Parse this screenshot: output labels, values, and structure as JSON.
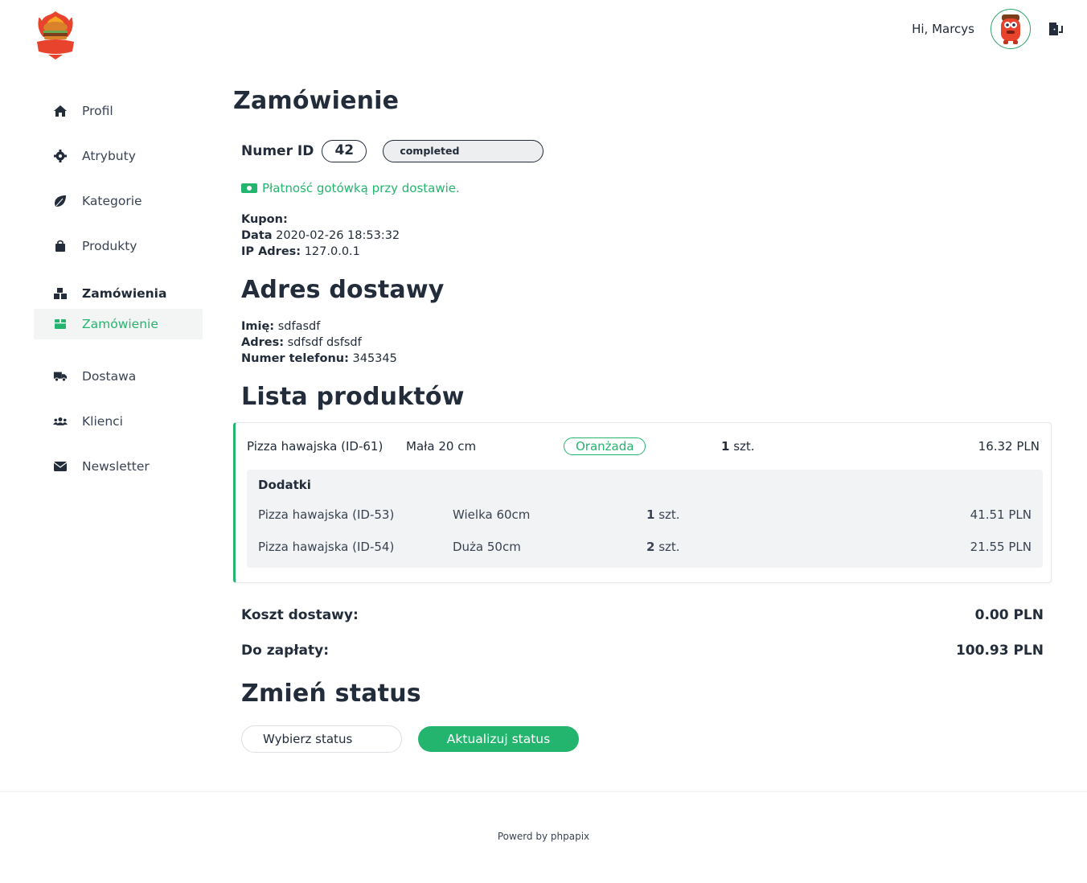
{
  "header": {
    "logo_text": "Burger",
    "greeting": "Hi, Marcys"
  },
  "sidebar": {
    "items": [
      {
        "label": "Profil",
        "icon": "home-icon"
      },
      {
        "label": "Atrybuty",
        "icon": "gear-icon"
      },
      {
        "label": "Kategorie",
        "icon": "leaf-icon"
      },
      {
        "label": "Produkty",
        "icon": "shopping-bag-icon"
      },
      {
        "label": "Zamówienia",
        "icon": "boxes-icon"
      },
      {
        "label": "Zamówienie",
        "icon": "package-icon"
      },
      {
        "label": "Dostawa",
        "icon": "truck-icon"
      },
      {
        "label": "Klienci",
        "icon": "users-icon"
      },
      {
        "label": "Newsletter",
        "icon": "envelope-icon"
      }
    ]
  },
  "order": {
    "title": "Zamówienie",
    "id_label": "Numer ID",
    "id": "42",
    "status": "completed",
    "payment": "Płatność gotówką przy dostawie.",
    "coupon_label": "Kupon:",
    "coupon_value": "",
    "date_label": "Data",
    "date_value": "2020-02-26 18:53:32",
    "ip_label": "IP Adres:",
    "ip_value": "127.0.0.1"
  },
  "address": {
    "title": "Adres dostawy",
    "name_label": "Imię:",
    "name_value": "sdfasdf",
    "address_label": "Adres:",
    "address_value": "sdfsdf dsfsdf",
    "phone_label": "Numer telefonu:",
    "phone_value": "345345"
  },
  "products": {
    "title": "Lista produktów",
    "items": [
      {
        "name": "Pizza hawajska (ID-61)",
        "size": "Mała 20 cm",
        "tag": "Oranżada",
        "qty": "1",
        "unit": "szt.",
        "price": "16.32 PLN",
        "addons_title": "Dodatki",
        "addons": [
          {
            "name": "Pizza hawajska (ID-53)",
            "size": "Wielka 60cm",
            "qty": "1",
            "unit": "szt.",
            "price": "41.51 PLN"
          },
          {
            "name": "Pizza hawajska (ID-54)",
            "size": "Duża 50cm",
            "qty": "2",
            "unit": "szt.",
            "price": "21.55 PLN"
          }
        ]
      }
    ]
  },
  "totals": {
    "delivery_label": "Koszt dostawy:",
    "delivery_value": "0.00 PLN",
    "total_label": "Do zapłaty:",
    "total_value": "100.93 PLN"
  },
  "status_change": {
    "title": "Zmień status",
    "select_placeholder": "Wybierz status",
    "button_label": "Aktualizuj status"
  },
  "footer": {
    "text": "Powerd by phpapix"
  },
  "colors": {
    "accent": "#23b56e",
    "text": "#222c3a"
  }
}
